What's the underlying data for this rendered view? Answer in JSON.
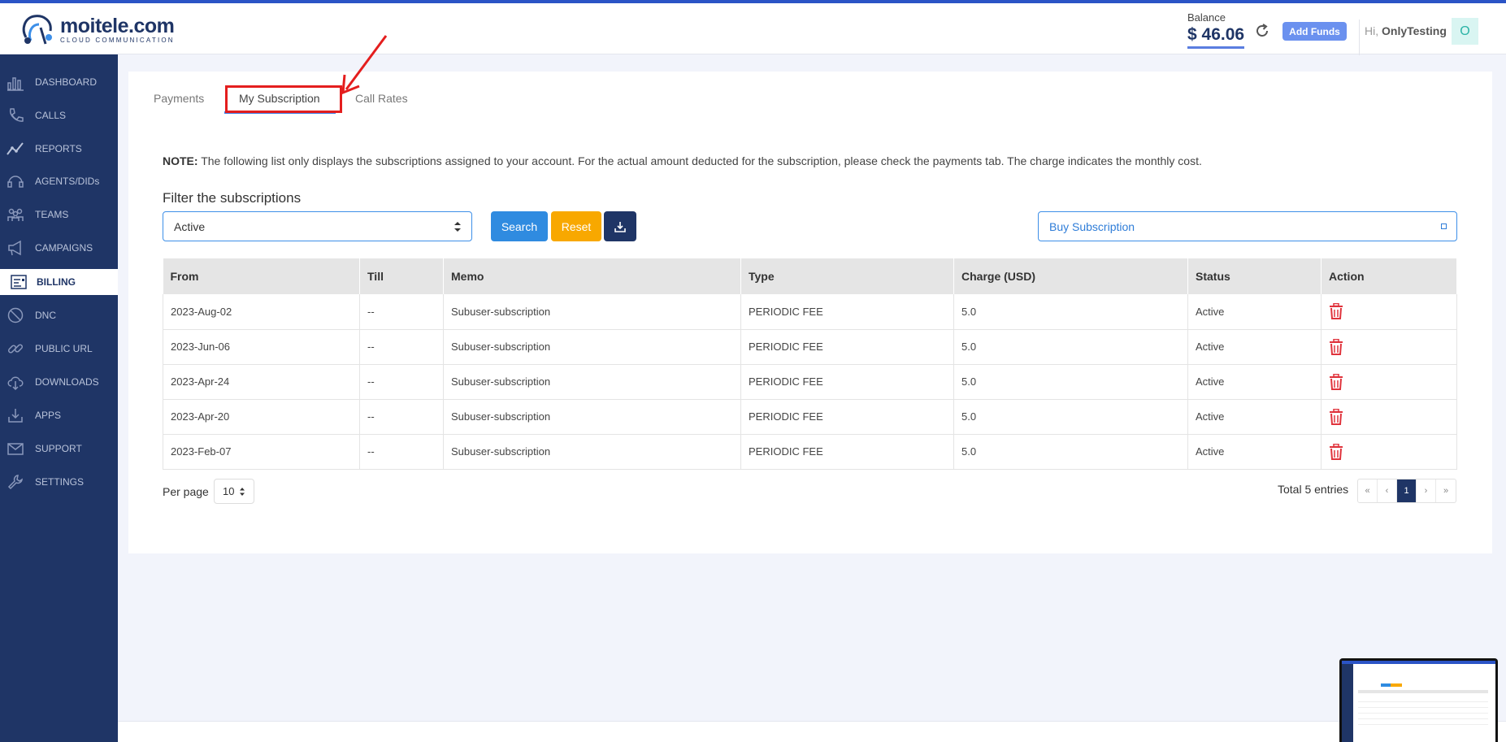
{
  "app": {
    "brand_name": "moitele.com",
    "brand_tagline": "CLOUD COMMUNICATION"
  },
  "header": {
    "balance_label": "Balance",
    "balance_value": "$ 46.06",
    "add_funds_label": "Add Funds",
    "greeting_prefix": "Hi,",
    "user_name": "OnlyTesting",
    "avatar_initial": "O"
  },
  "sidebar": {
    "items": [
      {
        "label": "DASHBOARD",
        "icon": "dashboard-icon"
      },
      {
        "label": "CALLS",
        "icon": "phone-icon"
      },
      {
        "label": "REPORTS",
        "icon": "chart-line-icon"
      },
      {
        "label": "AGENTS/DIDs",
        "icon": "headset-icon"
      },
      {
        "label": "TEAMS",
        "icon": "team-icon"
      },
      {
        "label": "CAMPAIGNS",
        "icon": "megaphone-icon"
      },
      {
        "label": "BILLING",
        "icon": "invoice-icon"
      },
      {
        "label": "DNC",
        "icon": "block-icon"
      },
      {
        "label": "PUBLIC URL",
        "icon": "link-icon"
      },
      {
        "label": "DOWNLOADS",
        "icon": "cloud-download-icon"
      },
      {
        "label": "APPS",
        "icon": "download-tray-icon"
      },
      {
        "label": "SUPPORT",
        "icon": "mail-icon"
      },
      {
        "label": "SETTINGS",
        "icon": "wrench-icon"
      }
    ],
    "active": "BILLING"
  },
  "tabs": [
    {
      "label": "Payments"
    },
    {
      "label": "My Subscription"
    },
    {
      "label": "Call Rates"
    }
  ],
  "note": {
    "prefix": "NOTE:",
    "text": " The following list only displays the subscriptions assigned to your account. For the actual amount deducted for the subscription, please check the payments tab. The charge indicates the monthly cost."
  },
  "filter": {
    "title": "Filter the subscriptions",
    "status_value": "Active",
    "search_label": "Search",
    "reset_label": "Reset",
    "buy_placeholder": "Buy Subscription"
  },
  "table": {
    "columns": [
      "From",
      "Till",
      "Memo",
      "Type",
      "Charge (USD)",
      "Status",
      "Action"
    ],
    "rows": [
      [
        "2023-Aug-02",
        "--",
        "Subuser-subscription",
        "PERIODIC FEE",
        "5.0",
        "Active"
      ],
      [
        "2023-Jun-06",
        "--",
        "Subuser-subscription",
        "PERIODIC FEE",
        "5.0",
        "Active"
      ],
      [
        "2023-Apr-24",
        "--",
        "Subuser-subscription",
        "PERIODIC FEE",
        "5.0",
        "Active"
      ],
      [
        "2023-Apr-20",
        "--",
        "Subuser-subscription",
        "PERIODIC FEE",
        "5.0",
        "Active"
      ],
      [
        "2023-Feb-07",
        "--",
        "Subuser-subscription",
        "PERIODIC FEE",
        "5.0",
        "Active"
      ]
    ]
  },
  "pagination": {
    "per_page_label": "Per page",
    "per_page_value": "10",
    "total_text": "Total 5 entries",
    "first": "«",
    "prev": "‹",
    "current": "1",
    "next": "›",
    "last": "»"
  },
  "colors": {
    "sidebar_bg": "#1f3566",
    "accent_blue": "#2f8be0",
    "reset_orange": "#f8a800",
    "delete_red": "#e0333c",
    "annotation_red": "#e41e1e"
  }
}
